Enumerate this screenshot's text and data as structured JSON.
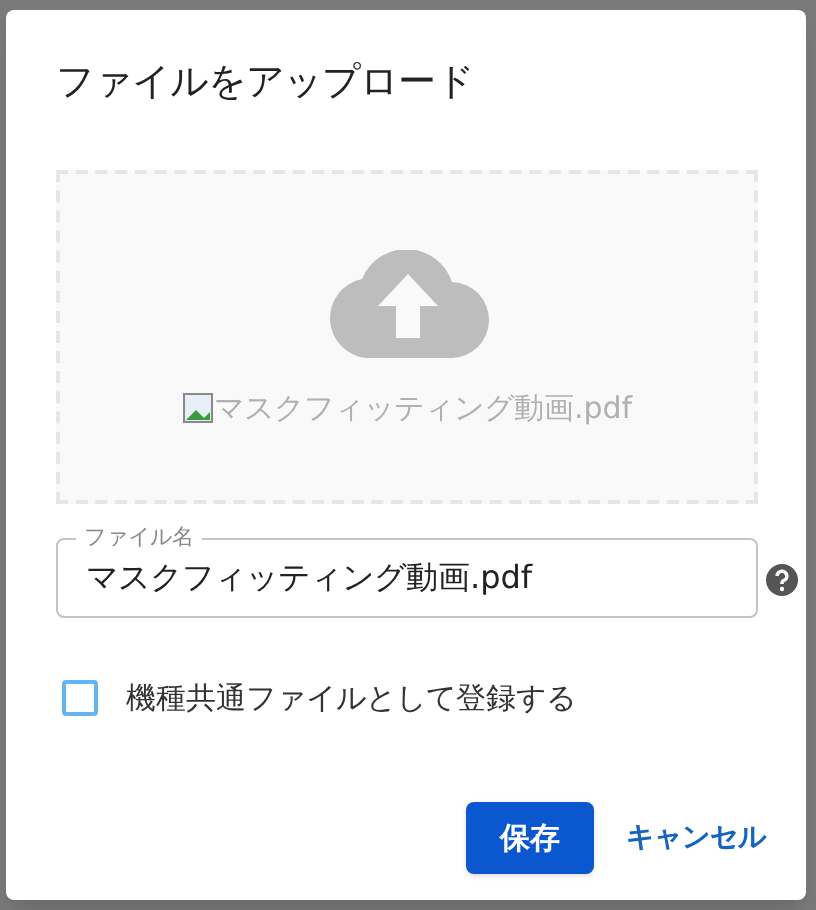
{
  "dialog": {
    "title": "ファイルをアップロード"
  },
  "dropzone": {
    "preview_text": "マスクフィッティング動画.pdf"
  },
  "file_name_field": {
    "label": "ファイル名",
    "value": "マスクフィッティング動画.pdf"
  },
  "checkbox": {
    "label": "機種共通ファイルとして登録する",
    "checked": false
  },
  "buttons": [
    {
      "label": "保存",
      "kind": "primary"
    },
    {
      "label": "キャンセル",
      "kind": "text"
    }
  ]
}
